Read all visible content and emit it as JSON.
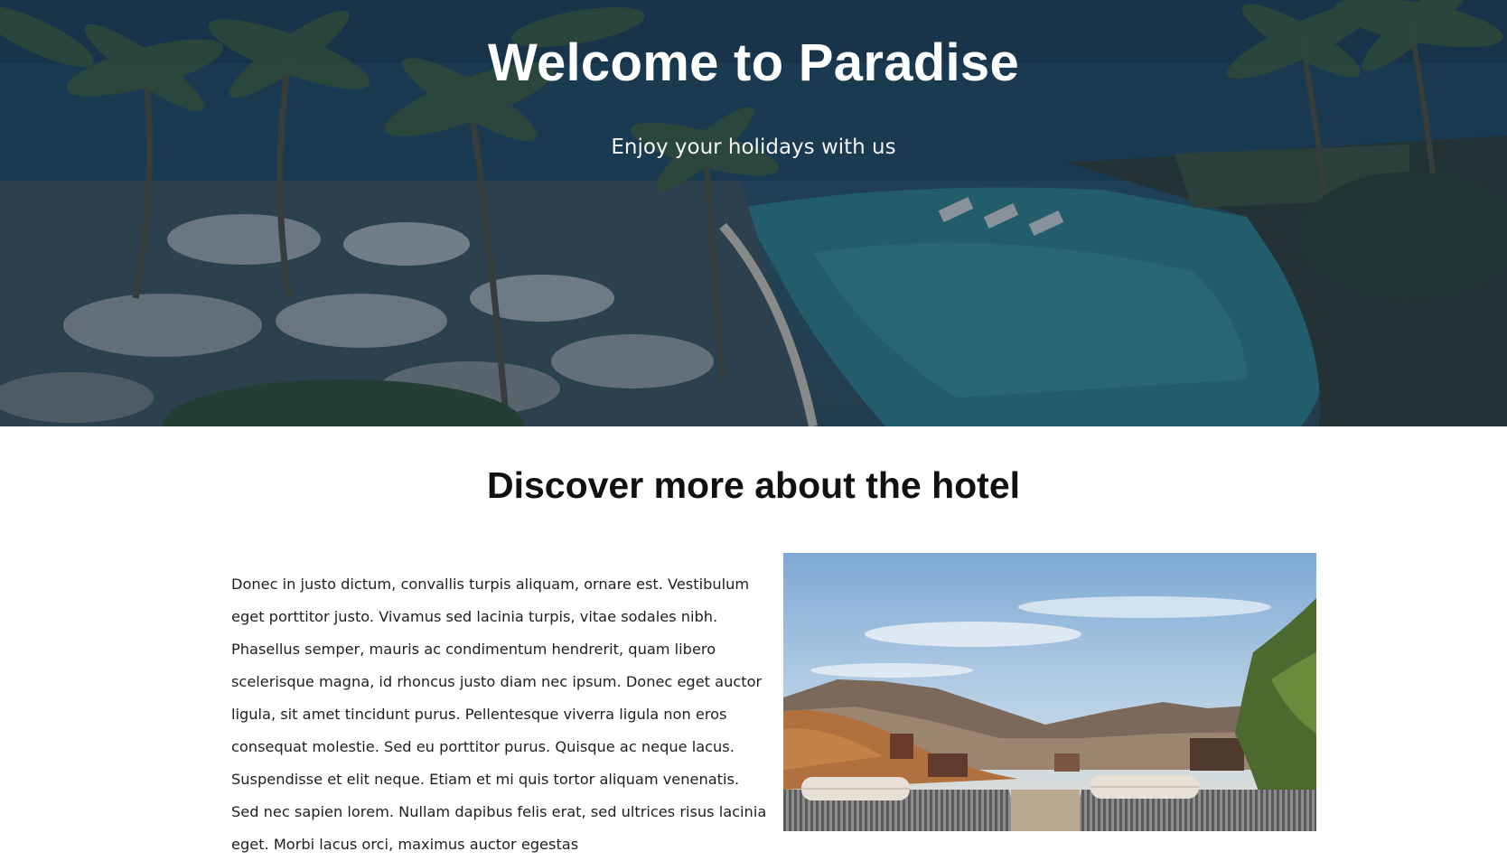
{
  "hero": {
    "title": "Welcome to Paradise",
    "subtitle": "Enjoy your holidays with us"
  },
  "about": {
    "heading": "Discover more about the hotel",
    "body": "Donec in justo dictum, convallis turpis aliquam, ornare est. Vestibulum eget porttitor justo. Vivamus sed lacinia turpis, vitae sodales nibh. Phasellus semper, mauris ac condimentum hendrerit, quam libero scelerisque magna, id rhoncus justo diam nec ipsum. Donec eget auctor ligula, sit amet tincidunt purus. Pellentesque viverra ligula non eros consequat molestie. Sed eu porttitor purus. Quisque ac neque lacus. Suspendisse et elit neque. Etiam et mi quis tortor aliquam venenatis. Sed nec sapien lorem. Nullam dapibus felis erat, sed ultrices risus lacinia eget. Morbi lacus orci, maximus auctor egestas"
  },
  "colors": {
    "hero_overlay": "#12263a",
    "heading_text": "#111111",
    "body_text": "#1f1f1f",
    "page_background": "#ffffff"
  }
}
